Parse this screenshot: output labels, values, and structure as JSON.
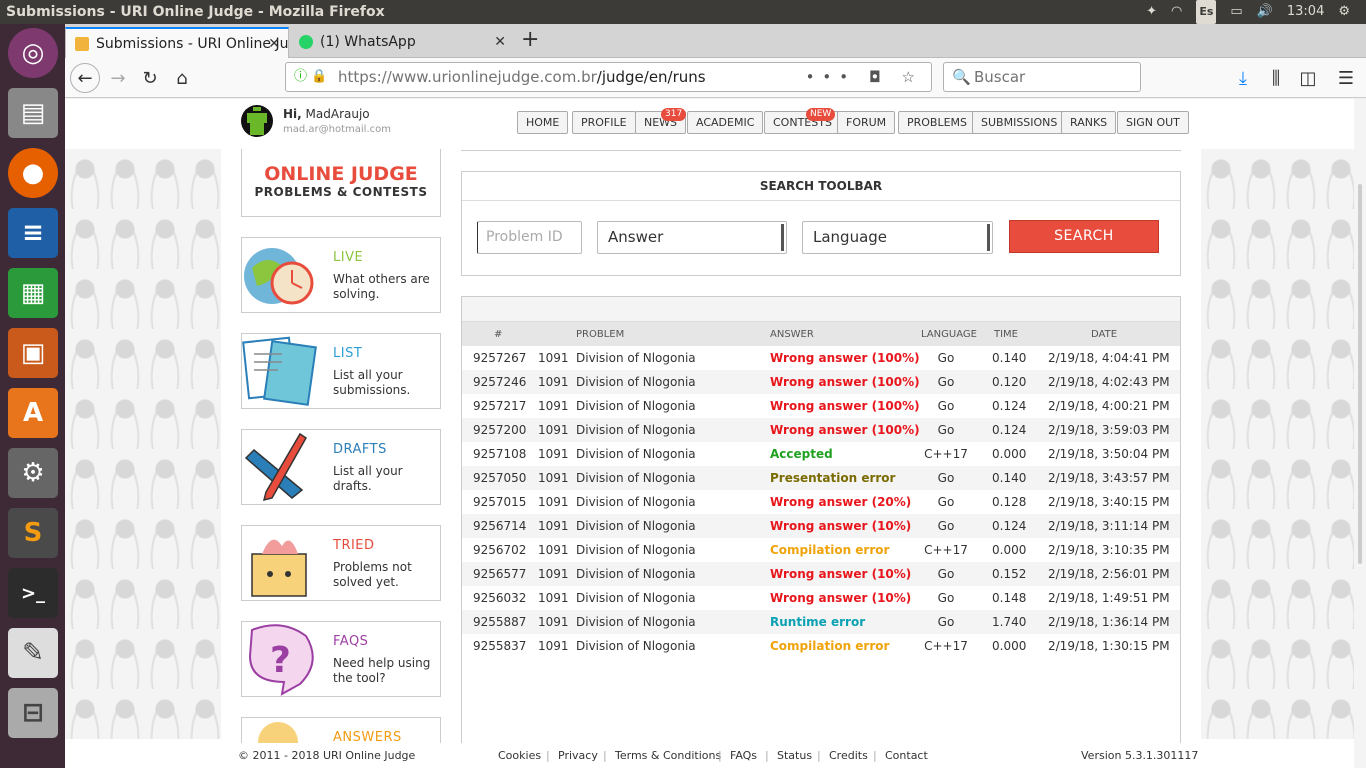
{
  "os": {
    "window_title": "Submissions - URI Online Judge - Mozilla Firefox",
    "keyboard": "Es",
    "clock": "13:04"
  },
  "browser": {
    "tabs": [
      {
        "label": "Submissions - URI Online Judge",
        "favicon": "trophy-icon"
      },
      {
        "label": "(1) WhatsApp",
        "favicon": "whatsapp-icon"
      }
    ],
    "url_host": "https://www.urionlinejudge.com.br",
    "url_path": "/judge/en/runs",
    "search_placeholder": "Buscar",
    "url_actions": "•••"
  },
  "header": {
    "greeting": "Hi,",
    "username": "MadAraujo",
    "email": "mad.ar@hotmail.com",
    "menu": [
      "HOME",
      "PROFILE",
      "NEWS",
      "ACADEMIC",
      "CONTESTS",
      "FORUM",
      "PROBLEMS",
      "SUBMISSIONS",
      "RANKS",
      "SIGN OUT"
    ],
    "news_badge": "317",
    "contests_badge": "NEW"
  },
  "sidebar": {
    "logo_line1": "ONLINE JUDGE",
    "logo_line2": "PROBLEMS & CONTESTS",
    "cards": [
      {
        "title": "LIVE",
        "desc": "What others are solving.",
        "color": "#8cc63f"
      },
      {
        "title": "LIST",
        "desc": "List all your submissions.",
        "color": "#2a9fd6"
      },
      {
        "title": "DRAFTS",
        "desc": "List all your drafts.",
        "color": "#2a7fb8"
      },
      {
        "title": "TRIED",
        "desc": "Problems not solved yet.",
        "color": "#e84c3d"
      },
      {
        "title": "FAQS",
        "desc": "Need help using the tool?",
        "color": "#9b3fa3"
      },
      {
        "title": "ANSWERS",
        "desc": "",
        "color": "#f39c12"
      }
    ]
  },
  "toolbar": {
    "title": "SEARCH TOOLBAR",
    "problem_placeholder": "Problem ID",
    "answer": "Answer",
    "language": "Language",
    "search_label": "SEARCH"
  },
  "table": {
    "headers": [
      "#",
      "PROBLEM",
      "ANSWER",
      "LANGUAGE",
      "TIME",
      "DATE"
    ],
    "rows": [
      {
        "id": "9257267",
        "pnum": "1091",
        "problem": "Division of Nlogonia",
        "answer": "Wrong answer (100%)",
        "lang": "Go",
        "time": "0.140",
        "date": "2/19/18, 4:04:41 PM"
      },
      {
        "id": "9257246",
        "pnum": "1091",
        "problem": "Division of Nlogonia",
        "answer": "Wrong answer (100%)",
        "lang": "Go",
        "time": "0.120",
        "date": "2/19/18, 4:02:43 PM"
      },
      {
        "id": "9257217",
        "pnum": "1091",
        "problem": "Division of Nlogonia",
        "answer": "Wrong answer (100%)",
        "lang": "Go",
        "time": "0.124",
        "date": "2/19/18, 4:00:21 PM"
      },
      {
        "id": "9257200",
        "pnum": "1091",
        "problem": "Division of Nlogonia",
        "answer": "Wrong answer (100%)",
        "lang": "Go",
        "time": "0.124",
        "date": "2/19/18, 3:59:03 PM"
      },
      {
        "id": "9257108",
        "pnum": "1091",
        "problem": "Division of Nlogonia",
        "answer": "Accepted",
        "lang": "C++17",
        "time": "0.000",
        "date": "2/19/18, 3:50:04 PM"
      },
      {
        "id": "9257050",
        "pnum": "1091",
        "problem": "Division of Nlogonia",
        "answer": "Presentation error",
        "lang": "Go",
        "time": "0.140",
        "date": "2/19/18, 3:43:57 PM"
      },
      {
        "id": "9257015",
        "pnum": "1091",
        "problem": "Division of Nlogonia",
        "answer": "Wrong answer (20%)",
        "lang": "Go",
        "time": "0.128",
        "date": "2/19/18, 3:40:15 PM"
      },
      {
        "id": "9256714",
        "pnum": "1091",
        "problem": "Division of Nlogonia",
        "answer": "Wrong answer (10%)",
        "lang": "Go",
        "time": "0.124",
        "date": "2/19/18, 3:11:14 PM"
      },
      {
        "id": "9256702",
        "pnum": "1091",
        "problem": "Division of Nlogonia",
        "answer": "Compilation error",
        "lang": "C++17",
        "time": "0.000",
        "date": "2/19/18, 3:10:35 PM"
      },
      {
        "id": "9256577",
        "pnum": "1091",
        "problem": "Division of Nlogonia",
        "answer": "Wrong answer (10%)",
        "lang": "Go",
        "time": "0.152",
        "date": "2/19/18, 2:56:01 PM"
      },
      {
        "id": "9256032",
        "pnum": "1091",
        "problem": "Division of Nlogonia",
        "answer": "Wrong answer (10%)",
        "lang": "Go",
        "time": "0.148",
        "date": "2/19/18, 1:49:51 PM"
      },
      {
        "id": "9255887",
        "pnum": "1091",
        "problem": "Division of Nlogonia",
        "answer": "Runtime error",
        "lang": "Go",
        "time": "1.740",
        "date": "2/19/18, 1:36:14 PM"
      },
      {
        "id": "9255837",
        "pnum": "1091",
        "problem": "Division of Nlogonia",
        "answer": "Compilation error",
        "lang": "C++17",
        "time": "0.000",
        "date": "2/19/18, 1:30:15 PM"
      }
    ]
  },
  "answer_colors": {
    "Wrong": "#e8161c",
    "Accepted": "#21a221",
    "Presentation": "#7a6b00",
    "Compilation": "#f0a30a",
    "Runtime": "#0aa1b3"
  },
  "footer": {
    "copyright": "© 2011 - 2018 URI Online Judge",
    "links": [
      "Cookies",
      "Privacy",
      "Terms & Conditions",
      "FAQs",
      "Status",
      "Credits",
      "Contact"
    ],
    "version": "Version 5.3.1.301117"
  }
}
